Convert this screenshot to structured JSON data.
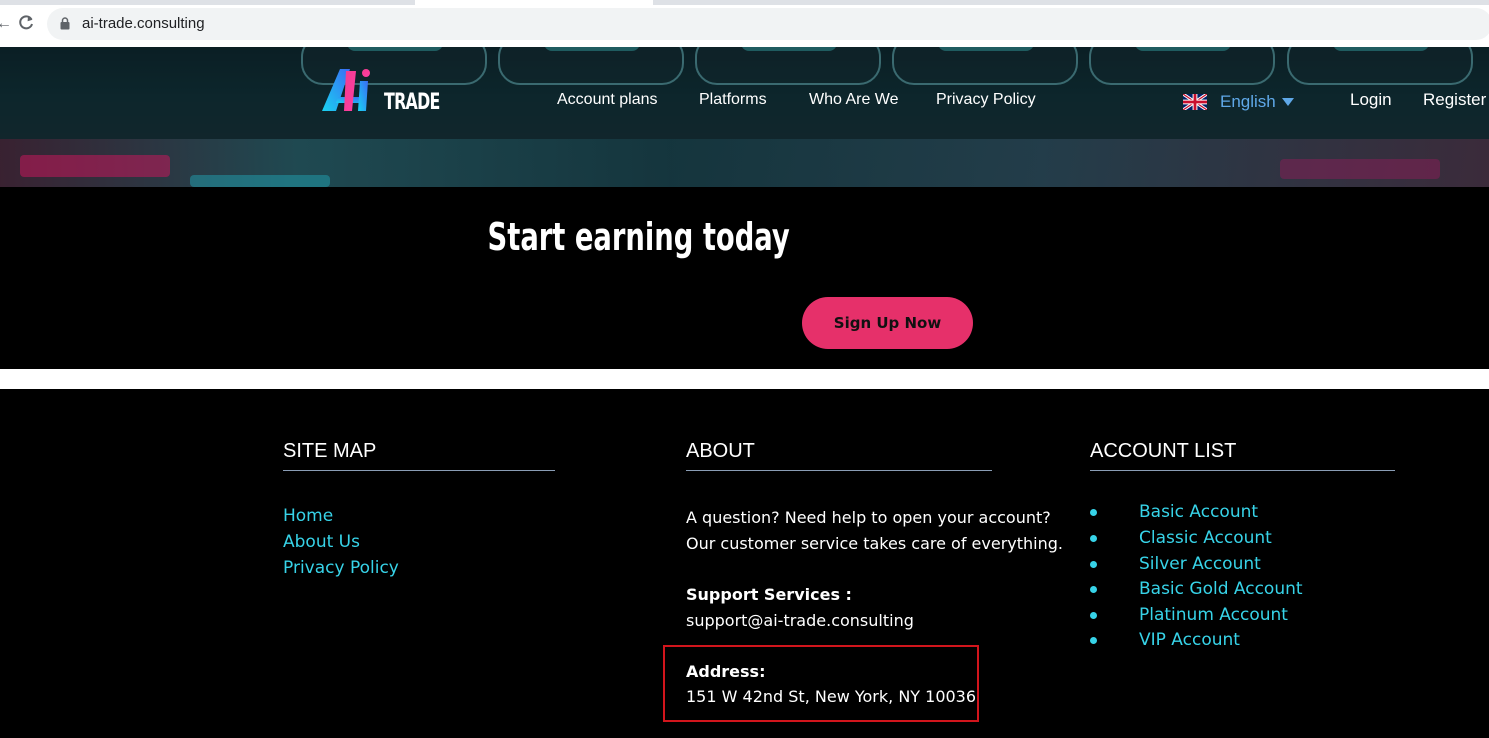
{
  "browser": {
    "url": "ai-trade.consulting"
  },
  "header": {
    "logo_text": "TRADE",
    "nav": [
      {
        "label": "Account plans"
      },
      {
        "label": "Platforms"
      },
      {
        "label": "Who Are We"
      },
      {
        "label": "Privacy Policy"
      }
    ],
    "language": {
      "label": "English",
      "flag": "uk-flag-icon"
    },
    "login_label": "Login",
    "register_label": "Register"
  },
  "cta": {
    "title": "Start earning today",
    "button_label": "Sign Up Now",
    "button_color": "#e6306a"
  },
  "footer": {
    "site_map": {
      "heading": "SITE MAP",
      "links": [
        "Home",
        "About Us",
        "Privacy Policy"
      ]
    },
    "about": {
      "heading": "ABOUT",
      "line1": "A question? Need help to open your account?",
      "line2": "Our customer service takes care of everything.",
      "support_label": "Support Services :",
      "support_email": "support@ai-trade.consulting",
      "address_label": "Address:",
      "address_value": "151 W 42nd St, New York, NY 10036"
    },
    "account_list": {
      "heading": "ACCOUNT LIST",
      "items": [
        "Basic Account",
        "Classic Account",
        "Silver Account",
        "Basic Gold Account",
        "Platinum Account",
        "VIP Account"
      ]
    },
    "link_color": "#37d3e8",
    "highlight_color": "#d2151c"
  }
}
